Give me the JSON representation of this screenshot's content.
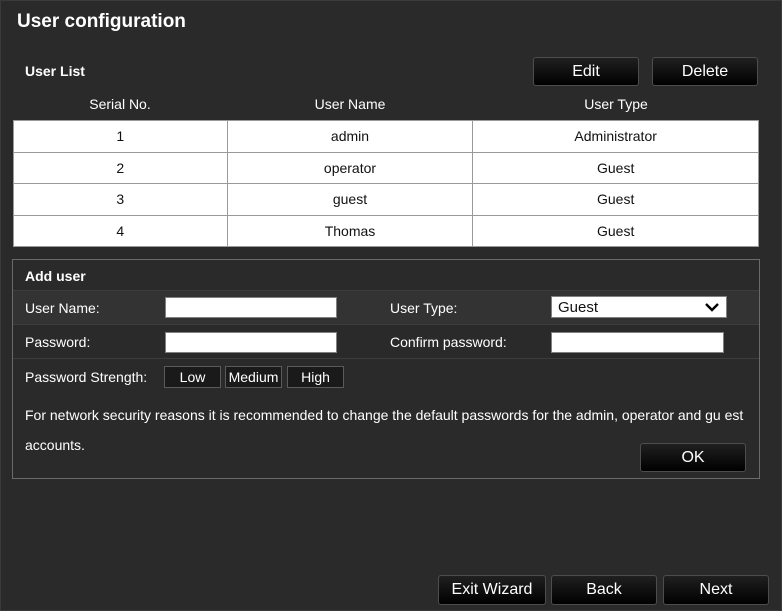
{
  "page": {
    "title": "User configuration"
  },
  "user_list": {
    "label": "User List",
    "edit_label": "Edit",
    "delete_label": "Delete",
    "columns": [
      "Serial No.",
      "User Name",
      "User Type"
    ],
    "rows": [
      [
        "1",
        "admin",
        "Administrator"
      ],
      [
        "2",
        "operator",
        "Guest"
      ],
      [
        "3",
        "guest",
        "Guest"
      ],
      [
        "4",
        "Thomas",
        "Guest"
      ]
    ]
  },
  "add_user": {
    "title": "Add user",
    "user_name_label": "User Name:",
    "user_name_value": "",
    "user_type_label": "User Type:",
    "user_type_value": "Guest",
    "password_label": "Password:",
    "password_value": "",
    "confirm_label": "Confirm password:",
    "confirm_value": "",
    "strength_label": "Password Strength:",
    "strength_levels": [
      "Low",
      "Medium",
      "High"
    ],
    "notice": "For network security reasons it is recommended to change the default passwords for the admin, operator and gu est accounts.",
    "ok_label": "OK"
  },
  "footer": {
    "exit_label": "Exit Wizard",
    "back_label": "Back",
    "next_label": "Next"
  },
  "colors": {
    "background": "#2a2a2a",
    "button": "#000000",
    "table_bg": "#ffffff"
  },
  "icons": {
    "user_type_dropdown": "chevron-down-icon"
  }
}
